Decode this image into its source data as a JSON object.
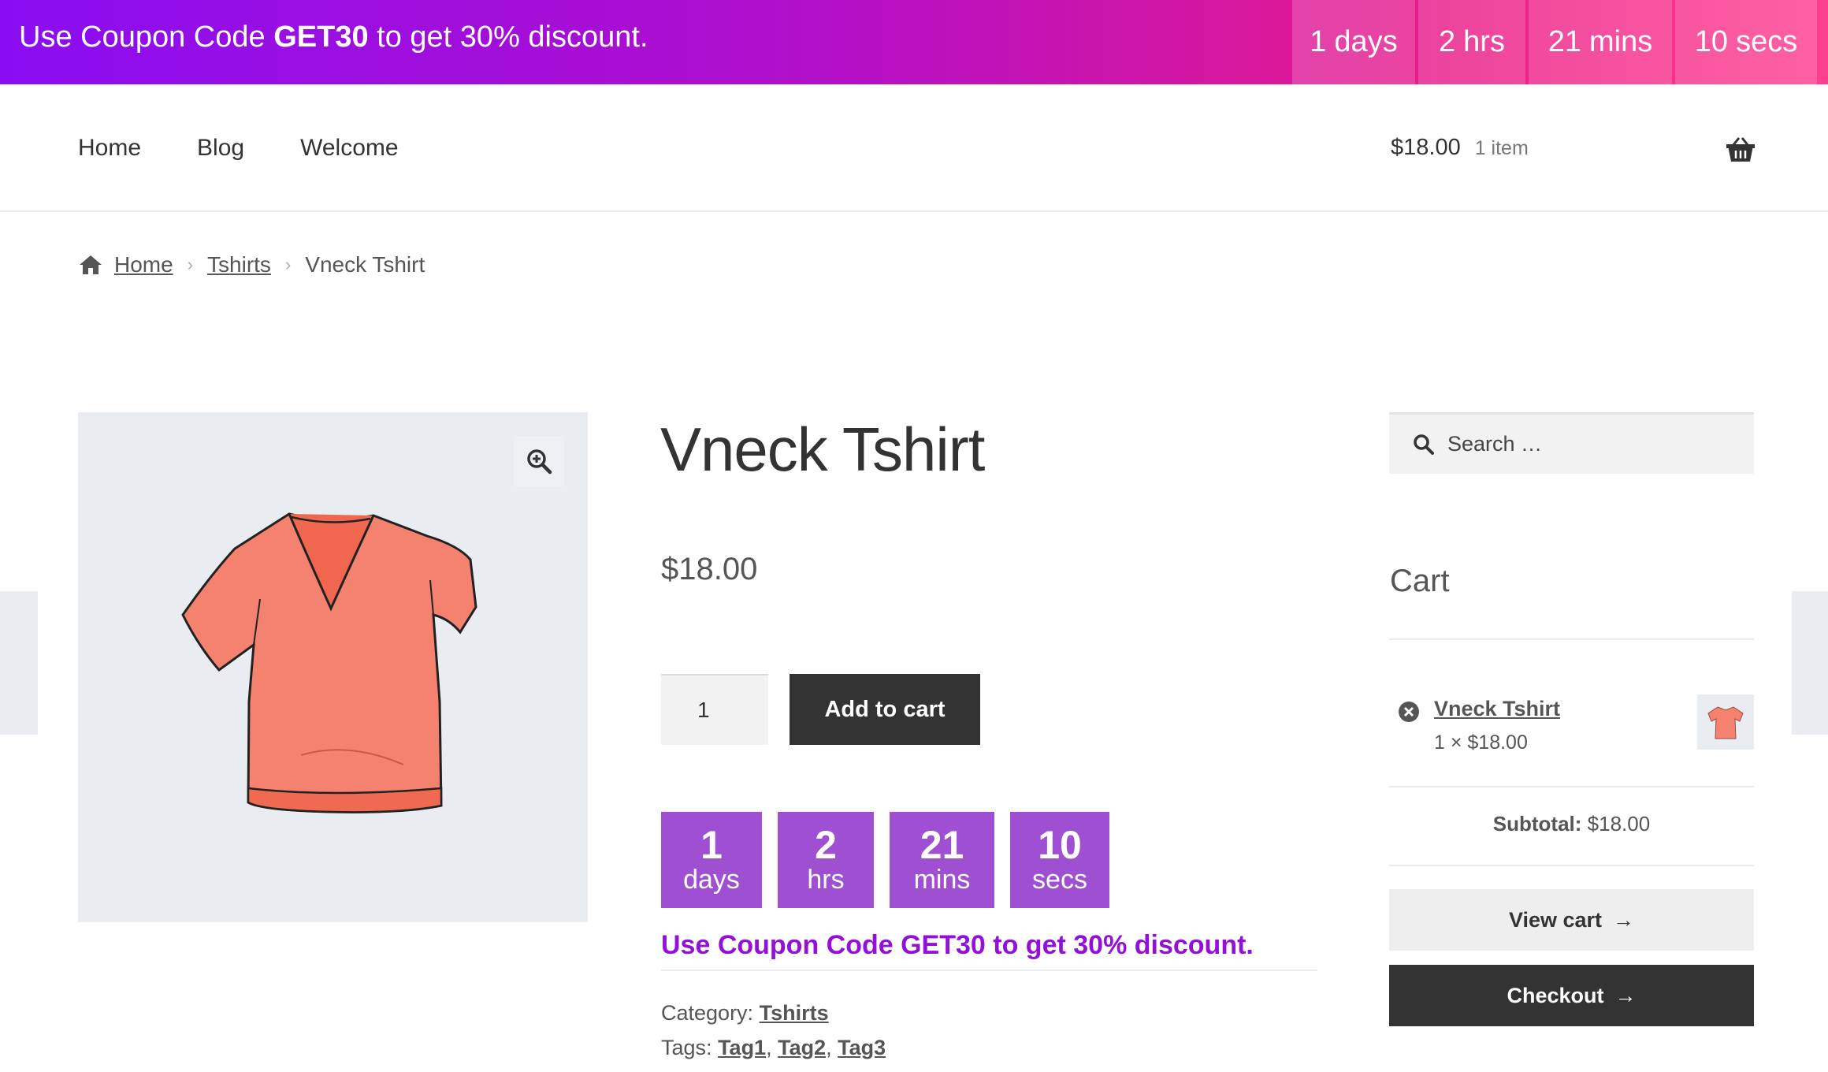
{
  "promo": {
    "text_prefix": "Use Coupon Code ",
    "code": "GET30",
    "text_suffix": " to get 30% discount.",
    "gradient_start": "#8a0df2",
    "gradient_end": "#ff3f8f",
    "timer": [
      {
        "value": "1",
        "unit": "days"
      },
      {
        "value": "2",
        "unit": "hrs"
      },
      {
        "value": "21",
        "unit": "mins"
      },
      {
        "value": "10",
        "unit": "secs"
      }
    ]
  },
  "nav": {
    "items": [
      "Home",
      "Blog",
      "Welcome"
    ]
  },
  "mini_cart": {
    "amount": "$18.00",
    "count": "1 item",
    "icon": "basket-icon"
  },
  "breadcrumb": {
    "home_icon": "home-icon",
    "items": [
      "Home",
      "Tshirts"
    ],
    "current": "Vneck Tshirt",
    "separator": "›"
  },
  "product": {
    "title": "Vneck Tshirt",
    "price": "$18.00",
    "quantity": "1",
    "add_to_cart": "Add to cart",
    "zoom_icon": "magnify-plus-icon",
    "image_color": "#f4826e"
  },
  "countdown": {
    "accent": "#9f4fd1",
    "boxes": [
      {
        "value": "1",
        "unit": "days"
      },
      {
        "value": "2",
        "unit": "hrs"
      },
      {
        "value": "21",
        "unit": "mins"
      },
      {
        "value": "10",
        "unit": "secs"
      }
    ],
    "message": "Use Coupon Code GET30 to get 30% discount.",
    "message_color": "#9310d8"
  },
  "meta": {
    "category_label": "Category:",
    "category": "Tshirts",
    "tags_label": "Tags:",
    "tags": [
      "Tag1",
      "Tag2",
      "Tag3"
    ]
  },
  "sidebar": {
    "search_placeholder": "Search …",
    "cart_title": "Cart",
    "cart_item": {
      "name": "Vneck Tshirt",
      "qty_line": "1 × $18.00"
    },
    "subtotal_label": "Subtotal:",
    "subtotal_value": "$18.00",
    "view_cart": "View cart",
    "checkout": "Checkout",
    "arrow_glyph": "→"
  }
}
